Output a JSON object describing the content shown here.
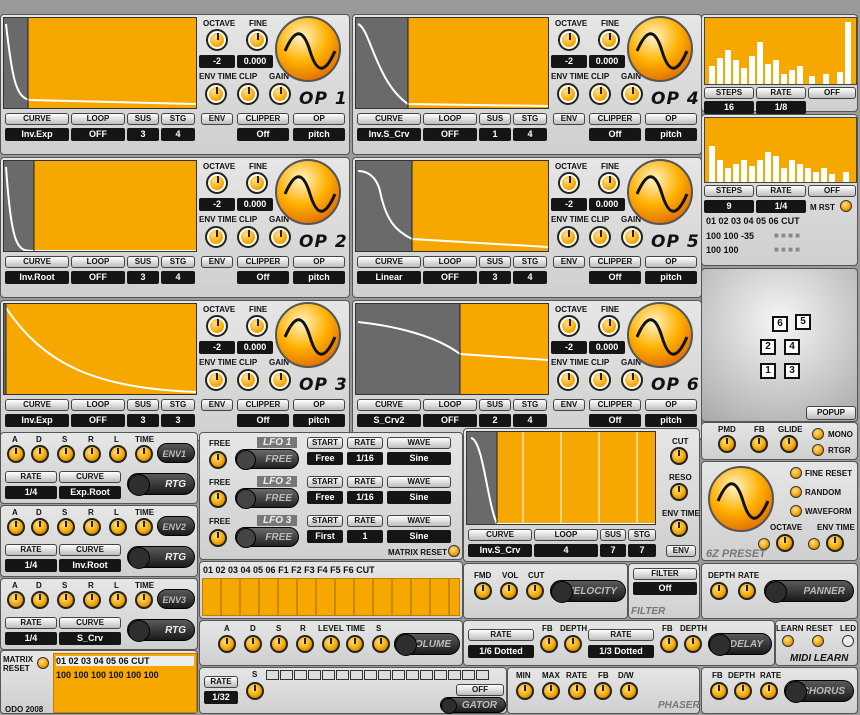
{
  "operators": [
    {
      "name": "OP 1",
      "octave": "-2",
      "fine": "0.000",
      "curve": "Inv.Exp",
      "loop": "OFF",
      "sus": "3",
      "stg": "4",
      "clipper": "Off",
      "op": "pitch"
    },
    {
      "name": "OP 2",
      "octave": "-2",
      "fine": "0.000",
      "curve": "Inv.Root",
      "loop": "OFF",
      "sus": "3",
      "stg": "4",
      "clipper": "Off",
      "op": "pitch"
    },
    {
      "name": "OP 3",
      "octave": "-2",
      "fine": "0.000",
      "curve": "Inv.Exp",
      "loop": "OFF",
      "sus": "3",
      "stg": "3",
      "clipper": "Off",
      "op": "pitch"
    },
    {
      "name": "OP 4",
      "octave": "-2",
      "fine": "0.000",
      "curve": "Inv.S_Crv",
      "loop": "OFF",
      "sus": "1",
      "stg": "4",
      "clipper": "Off",
      "op": "pitch"
    },
    {
      "name": "OP 5",
      "octave": "-2",
      "fine": "0.000",
      "curve": "Linear",
      "loop": "OFF",
      "sus": "3",
      "stg": "4",
      "clipper": "Off",
      "op": "pitch"
    },
    {
      "name": "OP 6",
      "octave": "-2",
      "fine": "0.000",
      "curve": "S_Crv2",
      "loop": "OFF",
      "sus": "2",
      "stg": "4",
      "clipper": "Off",
      "op": "pitch"
    }
  ],
  "op_labels": {
    "octave": "OCTAVE",
    "fine": "FINE",
    "env_time": "ENV TIME",
    "clip": "CLIP",
    "gain": "GAIN",
    "curve": "CURVE",
    "loop": "LOOP",
    "sus": "SUS",
    "stg": "STG",
    "env": "ENV",
    "clipper": "CLIPPER",
    "op": "OP"
  },
  "sequencers": [
    {
      "steps_label": "STEPS",
      "rate_label": "RATE",
      "off_label": "OFF",
      "steps": "16",
      "rate": "1/8"
    },
    {
      "steps_label": "STEPS",
      "rate_label": "RATE",
      "off_label": "OFF",
      "steps": "9",
      "rate": "1/4"
    }
  ],
  "m_rst": "M RST",
  "matrix_top": {
    "header": "01 02 03 04 05 06 CUT",
    "row1": "100 100 -35",
    "row2": "100 100"
  },
  "algo": {
    "boxes": [
      "6",
      "5",
      "2",
      "4",
      "1",
      "3"
    ],
    "popup": "POPUP"
  },
  "global": {
    "pmd": "PMD",
    "fb": "FB",
    "glide": "GLIDE",
    "mono": "MONO",
    "rtgr": "RTGR"
  },
  "envs": [
    {
      "labels": [
        "A",
        "D",
        "S",
        "R",
        "L",
        "TIME"
      ],
      "name": "ENV1",
      "rate_label": "RATE",
      "curve_label": "CURVE",
      "rate": "1/4",
      "curve": "Exp.Root",
      "rtg": "RTG"
    },
    {
      "labels": [
        "A",
        "D",
        "S",
        "R",
        "L",
        "TIME"
      ],
      "name": "ENV2",
      "rate_label": "RATE",
      "curve_label": "CURVE",
      "rate": "1/4",
      "curve": "Inv.Root",
      "rtg": "RTG"
    },
    {
      "labels": [
        "A",
        "D",
        "S",
        "R",
        "L",
        "TIME"
      ],
      "name": "ENV3",
      "rate_label": "RATE",
      "curve_label": "CURVE",
      "rate": "1/4",
      "curve": "S_Crv",
      "rtg": "RTG"
    }
  ],
  "lfos": [
    {
      "name": "LFO 1",
      "free": "FREE",
      "start_label": "START",
      "rate_label": "RATE",
      "wave_label": "WAVE",
      "start": "Free",
      "rate": "1/16",
      "wave": "Sine"
    },
    {
      "name": "LFO 2",
      "free": "FREE",
      "start_label": "START",
      "rate_label": "RATE",
      "wave_label": "WAVE",
      "start": "Free",
      "rate": "1/16",
      "wave": "Sine"
    },
    {
      "name": "LFO 3",
      "free": "FREE",
      "start_label": "START",
      "rate_label": "RATE",
      "wave_label": "WAVE",
      "start": "First",
      "rate": "1",
      "wave": "Sine"
    }
  ],
  "matrix_reset": "MATRIX RESET",
  "matrix_mid": {
    "header": "01 02 03 04 05 06 F1 F2 F3 F4 F5 F6 CUT"
  },
  "volume": {
    "labels": [
      "A",
      "D",
      "S",
      "R",
      "LEVEL",
      "TIME",
      "S"
    ],
    "name": "VOLUME"
  },
  "filter_env": {
    "curve_label": "CURVE",
    "loop_label": "LOOP",
    "sus_label": "SUS",
    "stg_label": "STG",
    "curve": "Inv.S_Crv",
    "loop": "4",
    "sus": "7",
    "stg": "7",
    "cut": "CUT",
    "reso": "RESO",
    "env_time": "ENV TIME",
    "env": "ENV"
  },
  "velocity": {
    "fmd": "FMD",
    "vol": "VOL",
    "cut": "CUT",
    "name": "VELOCITY"
  },
  "filter": {
    "label": "FILTER",
    "value": "Off",
    "name": "FILTER"
  },
  "preset": {
    "fine_reset": "FINE RESET",
    "random": "RANDOM",
    "waveform": "WAVEFORM",
    "octave": "OCTAVE",
    "env_time": "ENV TIME",
    "name": "6Z PRESET"
  },
  "panner": {
    "depth": "DEPTH",
    "rate": "RATE",
    "name": "PANNER"
  },
  "delay": {
    "rate_label": "RATE",
    "fb": "FB",
    "depth": "DEPTH",
    "rate1": "1/6 Dotted",
    "rate2": "1/3 Dotted",
    "name": "DELAY"
  },
  "midi": {
    "learn": "LEARN",
    "reset": "RESET",
    "led": "LED",
    "name": "MIDI LEARN"
  },
  "bottom_matrix": {
    "reset": "MATRIX RESET",
    "header": "01 02 03 04 05 06 CUT",
    "row": "100 100 100 100 100 100"
  },
  "gator": {
    "rate_label": "RATE",
    "rate": "1/32",
    "s": "S",
    "off": "OFF",
    "name": "GATOR"
  },
  "phaser": {
    "labels": [
      "MIN",
      "MAX",
      "RATE",
      "FB",
      "D/W"
    ],
    "name": "PHASER"
  },
  "chorus": {
    "labels": [
      "FB",
      "DEPTH",
      "RATE"
    ],
    "name": "CHORUS"
  },
  "credit": "ODO 2008"
}
